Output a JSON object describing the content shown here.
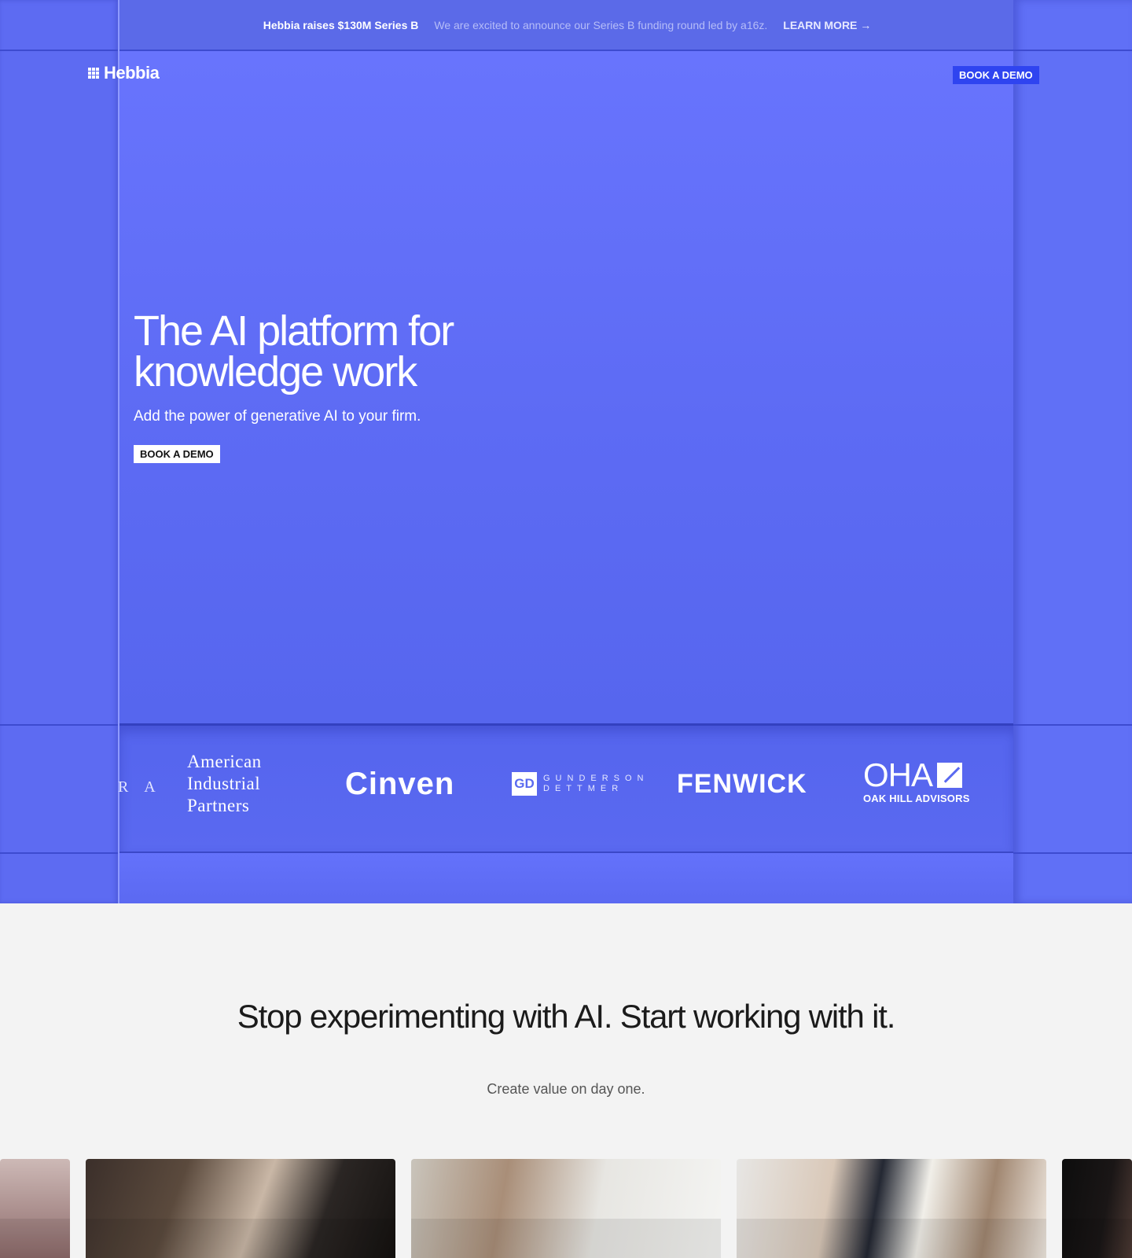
{
  "announcement": {
    "title": "Hebbia raises $130M Series B",
    "description": "We are excited to announce our Series B funding round led by a16z.",
    "link_label": "LEARN MORE →"
  },
  "nav": {
    "brand": "Hebbia",
    "cta_label": "BOOK A DEMO"
  },
  "hero": {
    "title": "The AI platform for knowledge work",
    "subtitle": "Add the power of generative AI to your firm.",
    "cta_label": "BOOK A DEMO"
  },
  "clients": {
    "partial": "R A",
    "aip_line1": "American",
    "aip_line2": "Industrial",
    "aip_line3": "Partners",
    "cinven": "Cinven",
    "gd_mark": "GD",
    "gd_line1": "GUNDERSON",
    "gd_line2": "DETTMER",
    "fenwick": "FENWICK",
    "oha": "OHA",
    "oha_sub": "OAK HILL ADVISORS"
  },
  "section2": {
    "title": "Stop experimenting with AI. Start working with it.",
    "subtitle": "Create value on day one."
  },
  "colors": {
    "hero_blue": "#5a6af0",
    "nav_button": "#2f44f0",
    "page_bg": "#f3f3f3"
  }
}
